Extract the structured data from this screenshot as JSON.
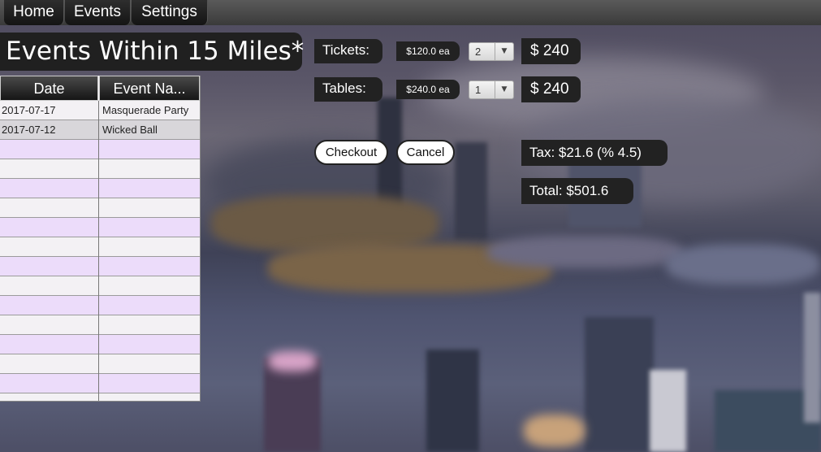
{
  "nav": {
    "home": "Home",
    "events": "Events",
    "settings": "Settings"
  },
  "page_title": "Events Within 15 Miles*",
  "table": {
    "columns": [
      "Date",
      "Event Na..."
    ],
    "rows": [
      [
        "2017-07-17",
        "Masquerade Party"
      ],
      [
        "2017-07-12",
        "Wicked Ball"
      ]
    ]
  },
  "tickets": {
    "label": "Tickets:",
    "price": "$120.0 ea",
    "quantity": "2",
    "total": "$ 240"
  },
  "tables": {
    "label": "Tables:",
    "price": "$240.0 ea",
    "quantity": "1",
    "total": "$ 240"
  },
  "actions": {
    "checkout": "Checkout",
    "cancel": "Cancel"
  },
  "summary": {
    "tax": "Tax: $21.6 (% 4.5)",
    "total": "Total: $501.6"
  },
  "icons": {
    "select_arrow": "chevron-down-icon"
  }
}
